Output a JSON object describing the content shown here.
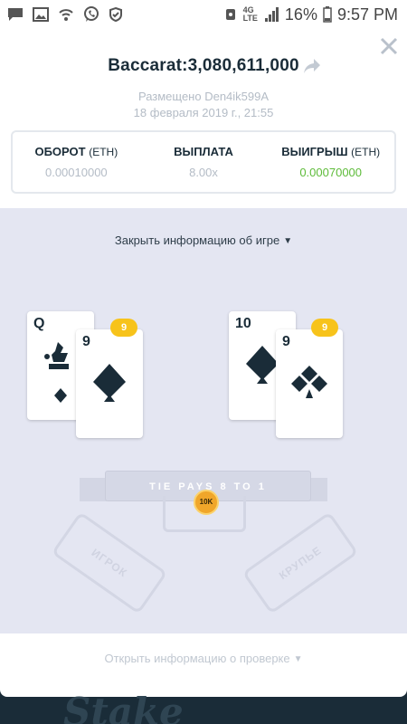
{
  "status_bar": {
    "battery": "16%",
    "time": "9:57 PM",
    "left_icons": [
      "message-icon",
      "image-icon",
      "wifi-call-icon",
      "viber-icon",
      "shield-icon"
    ],
    "right_icons": [
      "alarm-icon",
      "4g-lte-icon",
      "signal-icon",
      "battery-icon"
    ]
  },
  "modal": {
    "title": "Baccarat:3,080,611,000",
    "placed_by": "Размещено Den4ik599A",
    "placed_date": "18 февраля 2019 г., 21:55",
    "stats": [
      {
        "label": "ОБОРОТ",
        "unit": "(ETH)",
        "value": "0.00010000"
      },
      {
        "label": "ВЫПЛАТА",
        "unit": "",
        "value": "8.00x"
      },
      {
        "label": "ВЫИГРЫШ",
        "unit": "(ETH)",
        "value": "0.00070000"
      }
    ],
    "close_game_info": "Закрыть информацию об игре",
    "open_verify_info": "Открыть информацию о проверке"
  },
  "game": {
    "player_score": "9",
    "banker_score": "9",
    "player_cards": [
      {
        "rank": "Q",
        "suit": "clubs"
      },
      {
        "rank": "9",
        "suit": "spades"
      }
    ],
    "banker_cards": [
      {
        "rank": "10",
        "suit": "spades"
      },
      {
        "rank": "9",
        "suit": "clubs"
      }
    ],
    "tie_label": "TIE PAYS 8 TO 1",
    "chip_label": "10K",
    "player_zone": "ИГРОК",
    "banker_zone": "КРУПЬЕ"
  },
  "background": {
    "logo": "Stake"
  },
  "colors": {
    "dark": "#1a2c38",
    "muted": "#b4bcc6",
    "green": "#5dbb39",
    "game_bg": "#e4e6f2",
    "badge": "#f7c31b"
  }
}
